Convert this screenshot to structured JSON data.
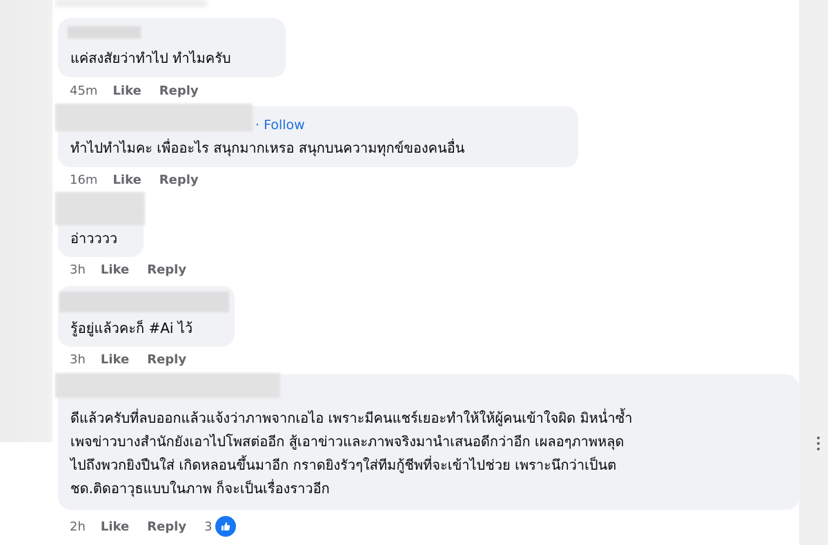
{
  "comments": [
    {
      "text": "แค่สงสัยว่าทำไป ทำไมครับ",
      "time": "45m",
      "like_label": "Like",
      "reply_label": "Reply"
    },
    {
      "follow_label": "· Follow",
      "text": "ทำไปทำไมคะ เพื่ออะไร สนุกมากเหรอ สนุกบนความทุกข์ของคนอื่น",
      "time": "16m",
      "like_label": "Like",
      "reply_label": "Reply"
    },
    {
      "text": "อ่าวววว",
      "time": "3h",
      "like_label": "Like",
      "reply_label": "Reply"
    },
    {
      "text": "รู้อยู่แล้วคะก็ #Ai ไว้",
      "time": "3h",
      "like_label": "Like",
      "reply_label": "Reply"
    },
    {
      "lines": [
        "ดีแล้วครับที่ลบออกแล้วแจ้งว่าภาพจากเอไอ เพราะมีคนแชร์เยอะทำให้ให้ผู้คนเข้าใจผิด มิหน่ำซ้ำ",
        "เพจข่าวบางสำนักยังเอาไปโพสต่ออีก สู้เอาข่าวและภาพจริงมานำเสนอดีกว่าอีก เผลอๆภาพหลุด",
        "ไปถึงพวกยิงปืนใส่ เกิดหลอนขึ้นมาอีก กราดยิงรัวๆใส่ทีมกู้ชีพที่จะเข้าไปช่วย เพราะนึกว่าเป็นต",
        "ชด.ติดอาวุธแบบในภาพ ก็จะเป็นเรื่องราวอีก"
      ],
      "time": "2h",
      "like_label": "Like",
      "reply_label": "Reply",
      "reaction_count": "3",
      "reaction_icon": "like-icon"
    }
  ],
  "colors": {
    "bubble": "#f0f2f5",
    "meta": "#65676b",
    "link": "#1e6fdc",
    "like_blue": "#1877f2"
  }
}
